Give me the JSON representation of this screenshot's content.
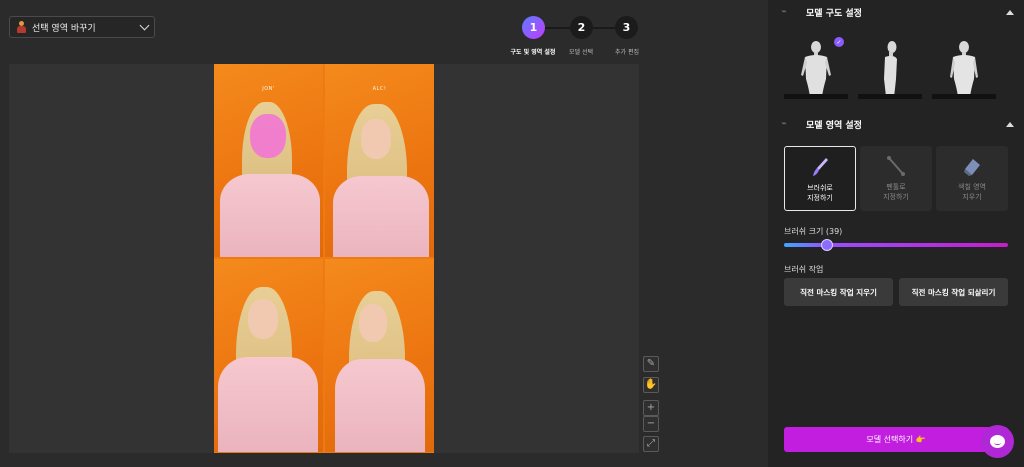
{
  "header": {
    "area_select": {
      "label": "선택 영역 바꾸기",
      "icon": "person-icon"
    }
  },
  "stepper": {
    "steps": [
      {
        "number": "1",
        "label": "구도 및 영역 설정",
        "active": true
      },
      {
        "number": "2",
        "label": "모델 선택",
        "active": false
      },
      {
        "number": "3",
        "label": "추가 편집",
        "active": false
      }
    ]
  },
  "canvas": {
    "photo_brands": [
      "JON'",
      "ALC!"
    ],
    "tools": {
      "pencil": "✎",
      "hand": "✋",
      "zoom_in": "+",
      "zoom_out": "−",
      "fit": "⤢"
    }
  },
  "panel": {
    "model_composition": {
      "title": "모델 구도 설정",
      "poses": [
        {
          "name": "front",
          "selected": true
        },
        {
          "name": "side",
          "selected": false
        },
        {
          "name": "back",
          "selected": false
        }
      ],
      "selected_mark": "✓"
    },
    "model_area": {
      "title": "모델 영역 설정",
      "modes": [
        {
          "line1": "브러쉬로",
          "line2": "지정하기",
          "active": true
        },
        {
          "line1": "펜툴로",
          "line2": "지정하기",
          "active": false
        },
        {
          "line1": "색칠 영역",
          "line2": "지우기",
          "active": false
        }
      ],
      "brush_size_label": "브러쉬 크기 (39)",
      "brush_size": 39,
      "brush_size_fraction": 0.19,
      "brush_action_label": "브러쉬 작업",
      "undo_mask_button": "직전 마스킹 작업 지우기",
      "restore_mask_button": "직전 마스킹 작업 되살리기"
    },
    "primary_button": "모델 선택하기 👉"
  },
  "colors": {
    "accent": "#c21ee0",
    "step_active_start": "#5b7cff",
    "step_active_end": "#c23bff",
    "mask": "#f07ad0"
  }
}
